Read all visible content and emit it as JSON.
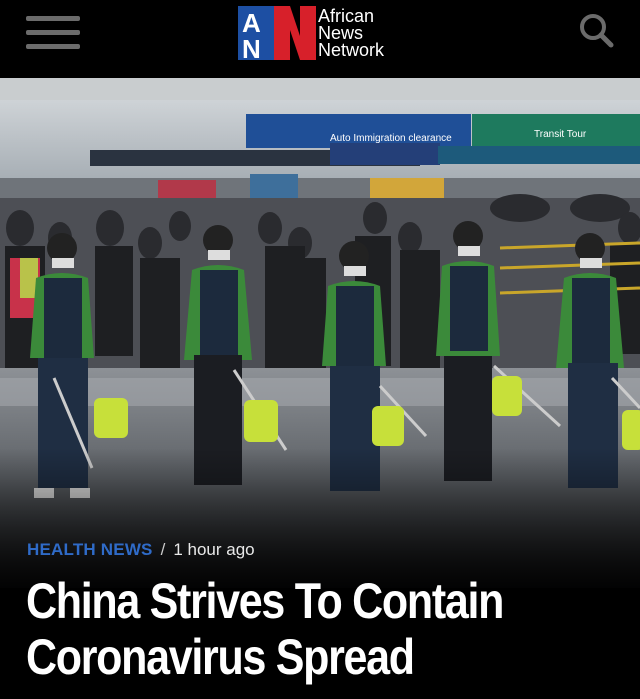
{
  "header": {
    "logo_letters": "AN",
    "logo_line1": "African",
    "logo_line2": "News",
    "logo_line3": "Network",
    "icons": [
      "hamburger-menu-icon",
      "search-icon"
    ],
    "colors": {
      "brand_red": "#d7202a",
      "brand_blue": "#1d4fa3",
      "background": "#000000"
    }
  },
  "article": {
    "category": "HEALTH NEWS",
    "separator": "/",
    "time_ago": "1 hour ago",
    "headline_line1": "China Strives To Contain",
    "headline_line2": "Coronavirus Spread",
    "category_color": "#2f6bc8"
  },
  "photo": {
    "signs": {
      "immigration_en": "Auto Immigration clearance",
      "transit": "Transit Tour"
    }
  }
}
